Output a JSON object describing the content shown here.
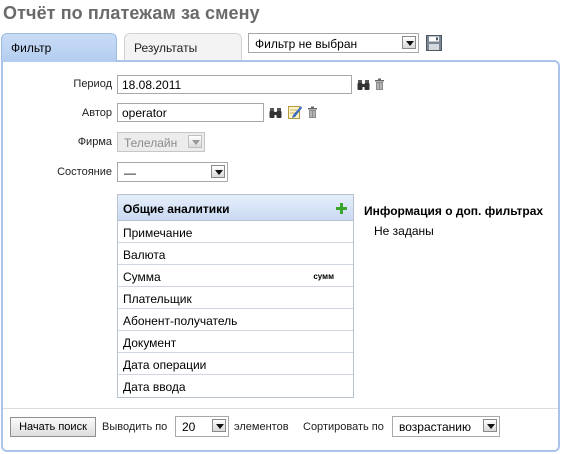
{
  "page": {
    "title": "Отчёт по платежам за смену"
  },
  "tabs": [
    {
      "label": "Фильтр",
      "active": true
    },
    {
      "label": "Результаты",
      "active": false
    }
  ],
  "filter_select": {
    "value": "Фильтр не выбран"
  },
  "form": {
    "period": {
      "label": "Период",
      "value": "18.08.2011"
    },
    "author": {
      "label": "Автор",
      "value": "operator"
    },
    "firm": {
      "label": "Фирма",
      "value": "Телелайн",
      "disabled": true
    },
    "state": {
      "label": "Состояние",
      "value": "—"
    }
  },
  "analytics": {
    "header": "Общие аналитики",
    "items": [
      {
        "label": "Примечание",
        "badge": ""
      },
      {
        "label": "Валюта",
        "badge": ""
      },
      {
        "label": "Сумма",
        "badge": "сумм"
      },
      {
        "label": "Плательщик",
        "badge": ""
      },
      {
        "label": "Абонент-получатель",
        "badge": ""
      },
      {
        "label": "Документ",
        "badge": ""
      },
      {
        "label": "Дата операции",
        "badge": ""
      },
      {
        "label": "Дата ввода",
        "badge": ""
      }
    ]
  },
  "extra_filters": {
    "title": "Информация о доп. фильтрах",
    "value": "Не заданы"
  },
  "footer": {
    "search_button": "Начать поиск",
    "show_label": "Выводить по",
    "page_size": "20",
    "elements_label": "элементов",
    "sort_label": "Сортировать по",
    "sort_order": "возрастанию"
  },
  "colors": {
    "accent": "#aac4ea",
    "tab_active": "#b3cdf0",
    "add_green": "#3aa32a"
  }
}
